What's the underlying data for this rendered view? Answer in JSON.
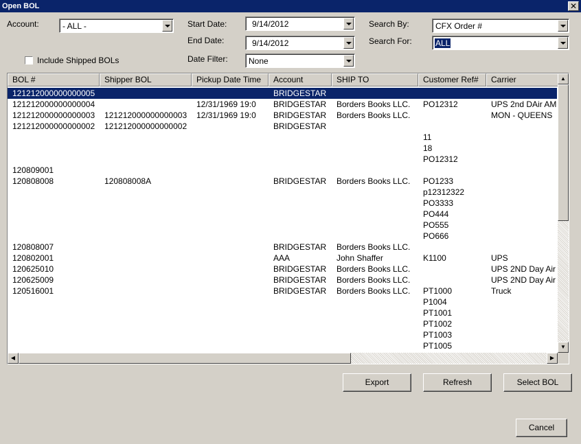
{
  "window": {
    "title": "Open BOL",
    "close_glyph": "✕"
  },
  "filters": {
    "account_label": "Account:",
    "account_value": "- ALL -",
    "start_date_label": "Start Date:",
    "start_date_value": "9/14/2012",
    "end_date_label": "End Date:",
    "end_date_value": "9/14/2012",
    "date_filter_label": "Date Filter:",
    "date_filter_value": "None",
    "search_by_label": "Search By:",
    "search_by_value": "CFX Order #",
    "search_for_label": "Search For:",
    "search_for_value": "ALL",
    "include_shipped_label": "Include Shipped BOLs",
    "include_shipped_checked": false
  },
  "grid": {
    "columns": [
      "BOL #",
      "Shipper BOL",
      "Pickup Date Time",
      "Account",
      "SHIP TO",
      "Customer Ref#",
      "Carrier"
    ],
    "rows": [
      [
        "121212000000000005",
        "",
        "",
        "BRIDGESTAR",
        "",
        "",
        ""
      ],
      [
        "121212000000000004",
        "",
        "12/31/1969 19:0",
        "BRIDGESTAR",
        "Borders Books LLC.",
        "PO12312",
        "UPS 2nd DAir AM"
      ],
      [
        "121212000000000003",
        "121212000000000003",
        "12/31/1969 19:0",
        "BRIDGESTAR",
        "Borders Books LLC.",
        "",
        "MON - QUEENS"
      ],
      [
        "121212000000000002",
        "121212000000000002",
        "",
        "BRIDGESTAR",
        "",
        "",
        ""
      ],
      [
        "",
        "",
        "",
        "",
        "",
        "11",
        ""
      ],
      [
        "",
        "",
        "",
        "",
        "",
        "18",
        ""
      ],
      [
        "",
        "",
        "",
        "",
        "",
        "PO12312",
        ""
      ],
      [
        "120809001",
        "",
        "",
        "",
        "",
        "",
        ""
      ],
      [
        "120808008",
        "120808008A",
        "",
        "BRIDGESTAR",
        "Borders Books LLC.",
        "PO1233",
        ""
      ],
      [
        "",
        "",
        "",
        "",
        "",
        "p12312322",
        ""
      ],
      [
        "",
        "",
        "",
        "",
        "",
        "PO3333",
        ""
      ],
      [
        "",
        "",
        "",
        "",
        "",
        "PO444",
        ""
      ],
      [
        "",
        "",
        "",
        "",
        "",
        "PO555",
        ""
      ],
      [
        "",
        "",
        "",
        "",
        "",
        "PO666",
        ""
      ],
      [
        "120808007",
        "",
        "",
        "BRIDGESTAR",
        "Borders Books LLC.",
        "",
        ""
      ],
      [
        "120802001",
        "",
        "",
        "AAA",
        "John Shaffer",
        "K1100",
        "UPS"
      ],
      [
        "120625010",
        "",
        "",
        "BRIDGESTAR",
        "Borders Books LLC.",
        "",
        "UPS 2ND Day Air"
      ],
      [
        "120625009",
        "",
        "",
        "BRIDGESTAR",
        "Borders Books LLC.",
        "",
        "UPS 2ND Day Air"
      ],
      [
        "120516001",
        "",
        "",
        "BRIDGESTAR",
        "Borders Books LLC.",
        "PT1000",
        "Truck"
      ],
      [
        "",
        "",
        "",
        "",
        "",
        "P1004",
        ""
      ],
      [
        "",
        "",
        "",
        "",
        "",
        "PT1001",
        ""
      ],
      [
        "",
        "",
        "",
        "",
        "",
        "PT1002",
        ""
      ],
      [
        "",
        "",
        "",
        "",
        "",
        "PT1003",
        ""
      ],
      [
        "",
        "",
        "",
        "",
        "",
        "PT1005",
        ""
      ]
    ],
    "selected_row": 0
  },
  "buttons": {
    "export": "Export",
    "refresh": "Refresh",
    "select_bol": "Select BOL",
    "cancel": "Cancel"
  },
  "scroll_glyphs": {
    "up": "▲",
    "down": "▼",
    "left": "◀",
    "right": "▶"
  }
}
